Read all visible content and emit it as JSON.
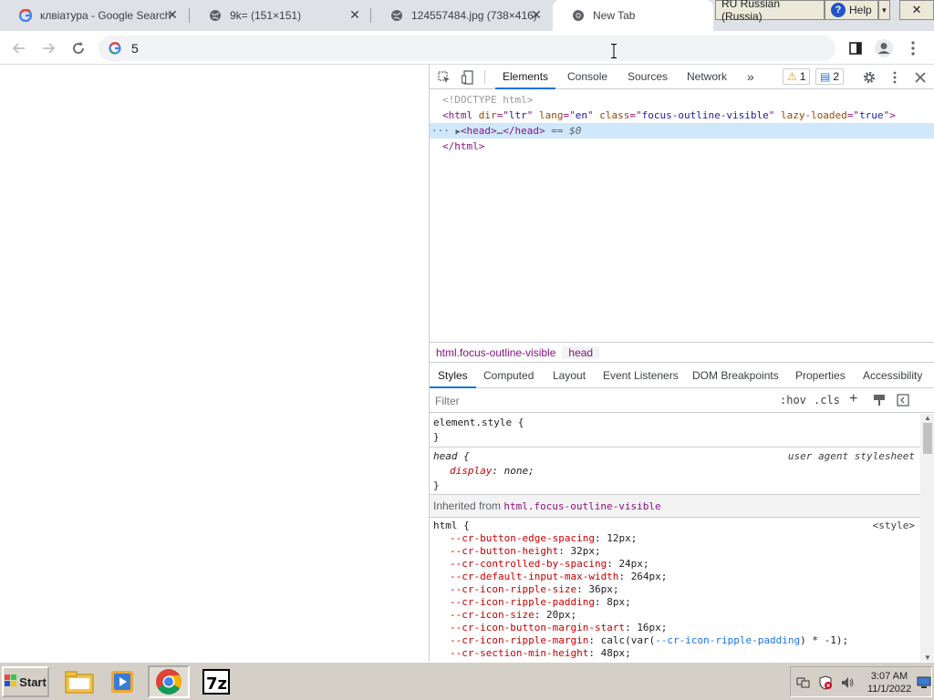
{
  "browser": {
    "tabs": [
      {
        "title": "клвіатура - Google Search",
        "favicon": "google-g-icon"
      },
      {
        "title": "9k= (151×151)",
        "favicon": "globe-icon"
      },
      {
        "title": "124557484.jpg (738×416)",
        "favicon": "globe-icon"
      },
      {
        "title": "New Tab",
        "favicon": "chrome-icon",
        "active": true
      }
    ],
    "omnibox_text": "5"
  },
  "langbar": {
    "language": "RU Russian (Russia)",
    "help": "Help"
  },
  "devtools": {
    "tabs": [
      "Elements",
      "Console",
      "Sources",
      "Network"
    ],
    "more": "»",
    "warnings": "1",
    "messages": "2",
    "dom": {
      "doctype": "<!DOCTYPE html>",
      "html_open": {
        "tag": "html",
        "attrs": [
          {
            "name": "dir",
            "value": "ltr"
          },
          {
            "name": "lang",
            "value": "en"
          },
          {
            "name": "class",
            "value": "focus-outline-visible"
          },
          {
            "name": "lazy-loaded",
            "value": "true"
          }
        ]
      },
      "head_collapsed": "<head>…</head>",
      "selected_marker": "== $0",
      "html_close": "</html>",
      "ellipsis": "···"
    },
    "breadcrumbs": [
      "html.focus-outline-visible",
      "head"
    ],
    "styles_tabs": [
      "Styles",
      "Computed",
      "Layout",
      "Event Listeners",
      "DOM Breakpoints",
      "Properties",
      "Accessibility"
    ],
    "filter_placeholder": "Filter",
    "hov": ":hov",
    "cls": ".cls",
    "plus": "+",
    "rules": {
      "element_style": "element.style {",
      "close": "}",
      "head_selector": "head {",
      "ua_source": "user agent stylesheet",
      "head_prop": "display",
      "head_val": "none;",
      "inherited_label": "Inherited from",
      "inherited_from": "html.focus-outline-visible",
      "html_selector": "html {",
      "html_source": "<style>",
      "html_props": [
        {
          "name": "--cr-button-edge-spacing",
          "value": "12px;"
        },
        {
          "name": "--cr-button-height",
          "value": "32px;"
        },
        {
          "name": "--cr-controlled-by-spacing",
          "value": "24px;"
        },
        {
          "name": "--cr-default-input-max-width",
          "value": "264px;"
        },
        {
          "name": "--cr-icon-ripple-size",
          "value": "36px;"
        },
        {
          "name": "--cr-icon-ripple-padding",
          "value": "8px;"
        },
        {
          "name": "--cr-icon-size",
          "value": "20px;"
        },
        {
          "name": "--cr-icon-button-margin-start",
          "value": "16px;"
        },
        {
          "name": "--cr-icon-ripple-margin",
          "value": "calc(var(--cr-icon-ripple-padding) * -1);"
        },
        {
          "name": "--cr-section-min-height",
          "value": "48px;"
        }
      ]
    }
  },
  "taskbar": {
    "start": "Start",
    "time": "3:07 AM",
    "date": "11/1/2022"
  },
  "colors": {
    "accent": "#1a73e8",
    "tabstrip": "#dee1e6",
    "taskbar": "#d4d0c8"
  }
}
